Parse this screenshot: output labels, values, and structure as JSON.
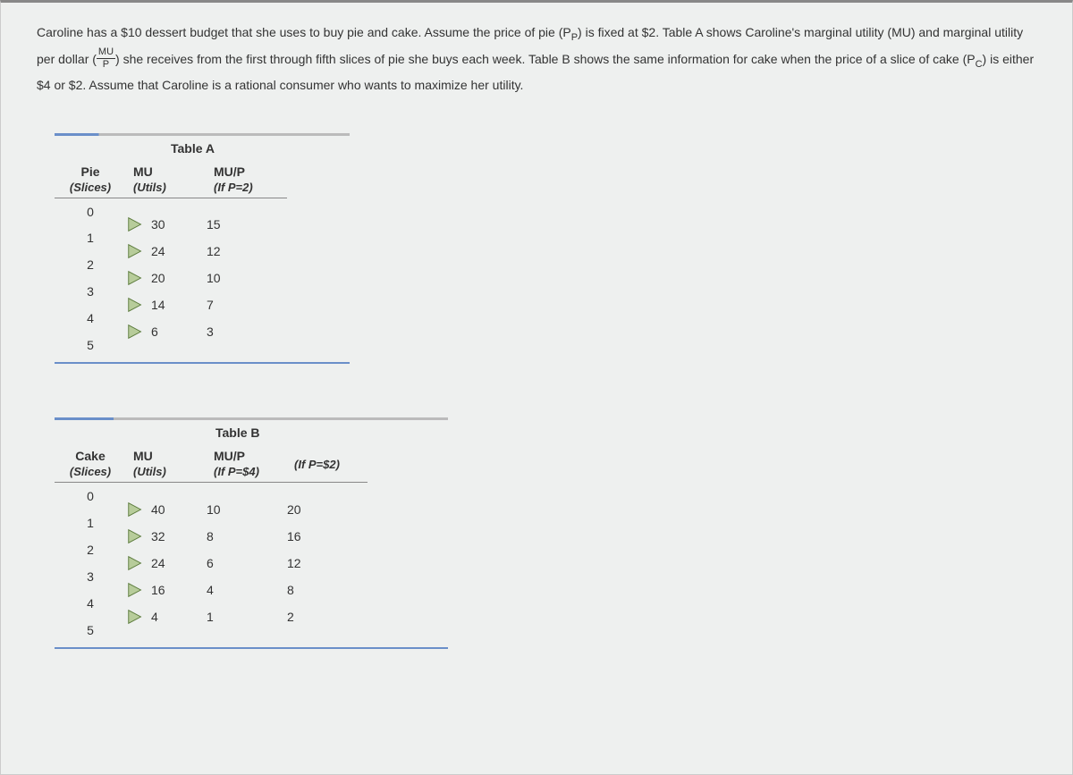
{
  "prompt": {
    "part1": "Caroline has a $10 dessert budget that she uses to buy pie and cake. Assume the price of pie (P",
    "sub1": "P",
    "part2": ") is fixed at $2. Table A shows Caroline's marginal utility (MU) and marginal utility per dollar (",
    "frac_num": "MU",
    "frac_den": "P",
    "part3": ") she receives from the first through fifth slices of pie she buys each week. Table B shows the same information for cake when the price of a slice of cake (P",
    "sub2": "C",
    "part4": ") is either $4 or $2. Assume that Caroline is a rational consumer who wants to maximize her utility."
  },
  "tableA": {
    "title": "Table A",
    "headers": {
      "col1_line1": "Pie",
      "col1_line2": "(Slices)",
      "col2_line1": "MU",
      "col2_line2": "(Utils)",
      "col3_line1": "MU/P",
      "col3_line2": "(If P=2)"
    },
    "slices": [
      "0",
      "1",
      "2",
      "3",
      "4",
      "5"
    ],
    "rows": [
      {
        "mu": "30",
        "mup": "15"
      },
      {
        "mu": "24",
        "mup": "12"
      },
      {
        "mu": "20",
        "mup": "10"
      },
      {
        "mu": "14",
        "mup": "7"
      },
      {
        "mu": "6",
        "mup": "3"
      }
    ]
  },
  "tableB": {
    "title": "Table B",
    "headers": {
      "col1_line1": "Cake",
      "col1_line2": "(Slices)",
      "col2_line1": "MU",
      "col2_line2": "(Utils)",
      "col3_line1": "MU/P",
      "col3_line2": "(If P=$4)",
      "col4_line1": "",
      "col4_line2": "(If P=$2)"
    },
    "slices": [
      "0",
      "1",
      "2",
      "3",
      "4",
      "5"
    ],
    "rows": [
      {
        "mu": "40",
        "mup4": "10",
        "mup2": "20"
      },
      {
        "mu": "32",
        "mup4": "8",
        "mup2": "16"
      },
      {
        "mu": "24",
        "mup4": "6",
        "mup2": "12"
      },
      {
        "mu": "16",
        "mup4": "4",
        "mup2": "8"
      },
      {
        "mu": "4",
        "mup4": "1",
        "mup2": "2"
      }
    ]
  },
  "chart_data": [
    {
      "type": "table",
      "title": "Table A",
      "columns": [
        "Pie (Slices)",
        "MU (Utils)",
        "MU/P (If P=2)"
      ],
      "rows": [
        [
          0,
          null,
          null
        ],
        [
          1,
          30,
          15
        ],
        [
          2,
          24,
          12
        ],
        [
          3,
          20,
          10
        ],
        [
          4,
          14,
          7
        ],
        [
          5,
          6,
          3
        ]
      ]
    },
    {
      "type": "table",
      "title": "Table B",
      "columns": [
        "Cake (Slices)",
        "MU (Utils)",
        "MU/P (If P=$4)",
        "MU/P (If P=$2)"
      ],
      "rows": [
        [
          0,
          null,
          null,
          null
        ],
        [
          1,
          40,
          10,
          20
        ],
        [
          2,
          32,
          8,
          16
        ],
        [
          3,
          24,
          6,
          12
        ],
        [
          4,
          16,
          4,
          8
        ],
        [
          5,
          4,
          1,
          2
        ]
      ]
    }
  ]
}
